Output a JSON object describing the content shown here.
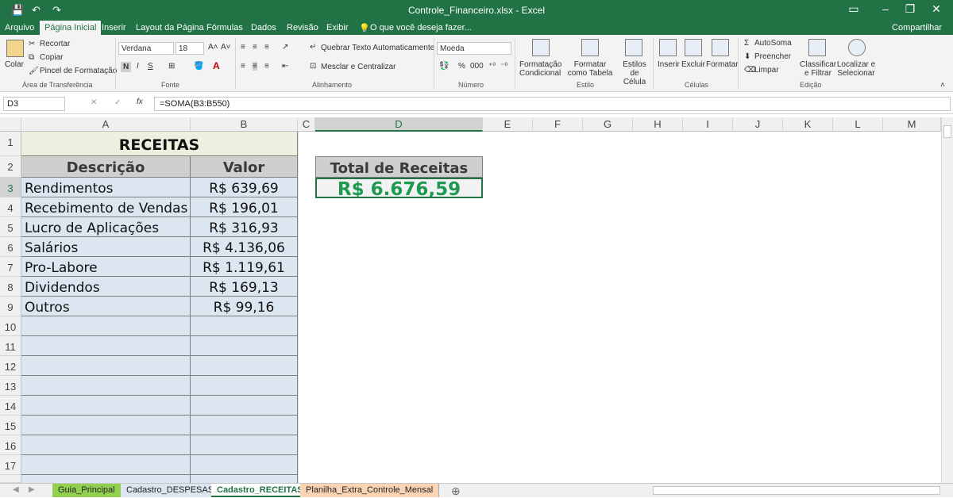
{
  "window": {
    "title": "Controle_Financeiro.xlsx - Excel"
  },
  "tabs": [
    "Arquivo",
    "Página Inicial",
    "Inserir",
    "Layout da Página",
    "Fórmulas",
    "Dados",
    "Revisão",
    "Exibir"
  ],
  "tell_me": "O que você deseja fazer...",
  "share": "Compartilhar",
  "ribbon": {
    "clipboard": {
      "paste": "Colar",
      "cut": "Recortar",
      "copy": "Copiar",
      "format_painter": "Pincel de Formatação",
      "label": "Área de Transferência"
    },
    "font": {
      "name": "Verdana",
      "size": "18",
      "bold": "N",
      "italic": "I",
      "underline": "S",
      "label": "Fonte"
    },
    "alignment": {
      "wrap": "Quebrar Texto Automaticamente",
      "merge": "Mesclar e Centralizar",
      "label": "Alinhamento"
    },
    "number": {
      "format": "Moeda",
      "label": "Número"
    },
    "styles": {
      "cond": "Formatação Condicional",
      "table": "Formatar como Tabela",
      "cell": "Estilos de Célula",
      "label": "Estilo"
    },
    "cells": {
      "insert": "Inserir",
      "delete": "Excluir",
      "format": "Formatar",
      "label": "Células"
    },
    "editing": {
      "autosum": "AutoSoma",
      "fill": "Preencher",
      "clear": "Limpar",
      "sort": "Classificar e Filtrar",
      "find": "Localizar e Selecionar",
      "label": "Edição"
    }
  },
  "formula_bar": {
    "name_box": "D3",
    "formula": "=SOMA(B3:B550)",
    "fx": "fx"
  },
  "columns": [
    "A",
    "B",
    "C",
    "D",
    "E",
    "F",
    "G",
    "H",
    "I",
    "J",
    "K",
    "L",
    "M"
  ],
  "rows": [
    "1",
    "2",
    "3",
    "4",
    "5",
    "6",
    "7",
    "8",
    "9",
    "10",
    "11",
    "12",
    "13",
    "14",
    "15",
    "16",
    "17"
  ],
  "sheet_content": {
    "title": "RECEITAS",
    "header_desc": "Descrição",
    "header_val": "Valor",
    "items": [
      {
        "desc": "Rendimentos",
        "val": "R$ 639,69"
      },
      {
        "desc": "Recebimento de Vendas",
        "val": "R$ 196,01"
      },
      {
        "desc": "Lucro de Aplicações",
        "val": "R$ 316,93"
      },
      {
        "desc": "Salários",
        "val": "R$ 4.136,06"
      },
      {
        "desc": "Pro-Labore",
        "val": "R$ 1.119,61"
      },
      {
        "desc": "Dividendos",
        "val": "R$ 169,13"
      },
      {
        "desc": "Outros",
        "val": "R$ 99,16"
      }
    ],
    "total_label": "Total de Receitas",
    "total_value": "R$ 6.676,59"
  },
  "sheets": [
    {
      "name": "Guia_Principal",
      "color": "#92d050"
    },
    {
      "name": "Cadastro_DESPESAS",
      "color": "#dce6f1"
    },
    {
      "name": "Cadastro_RECEITAS",
      "color": "#ffffff"
    },
    {
      "name": "Planilha_Extra_Controle_Mensal",
      "color": "#fbd4b4"
    }
  ]
}
